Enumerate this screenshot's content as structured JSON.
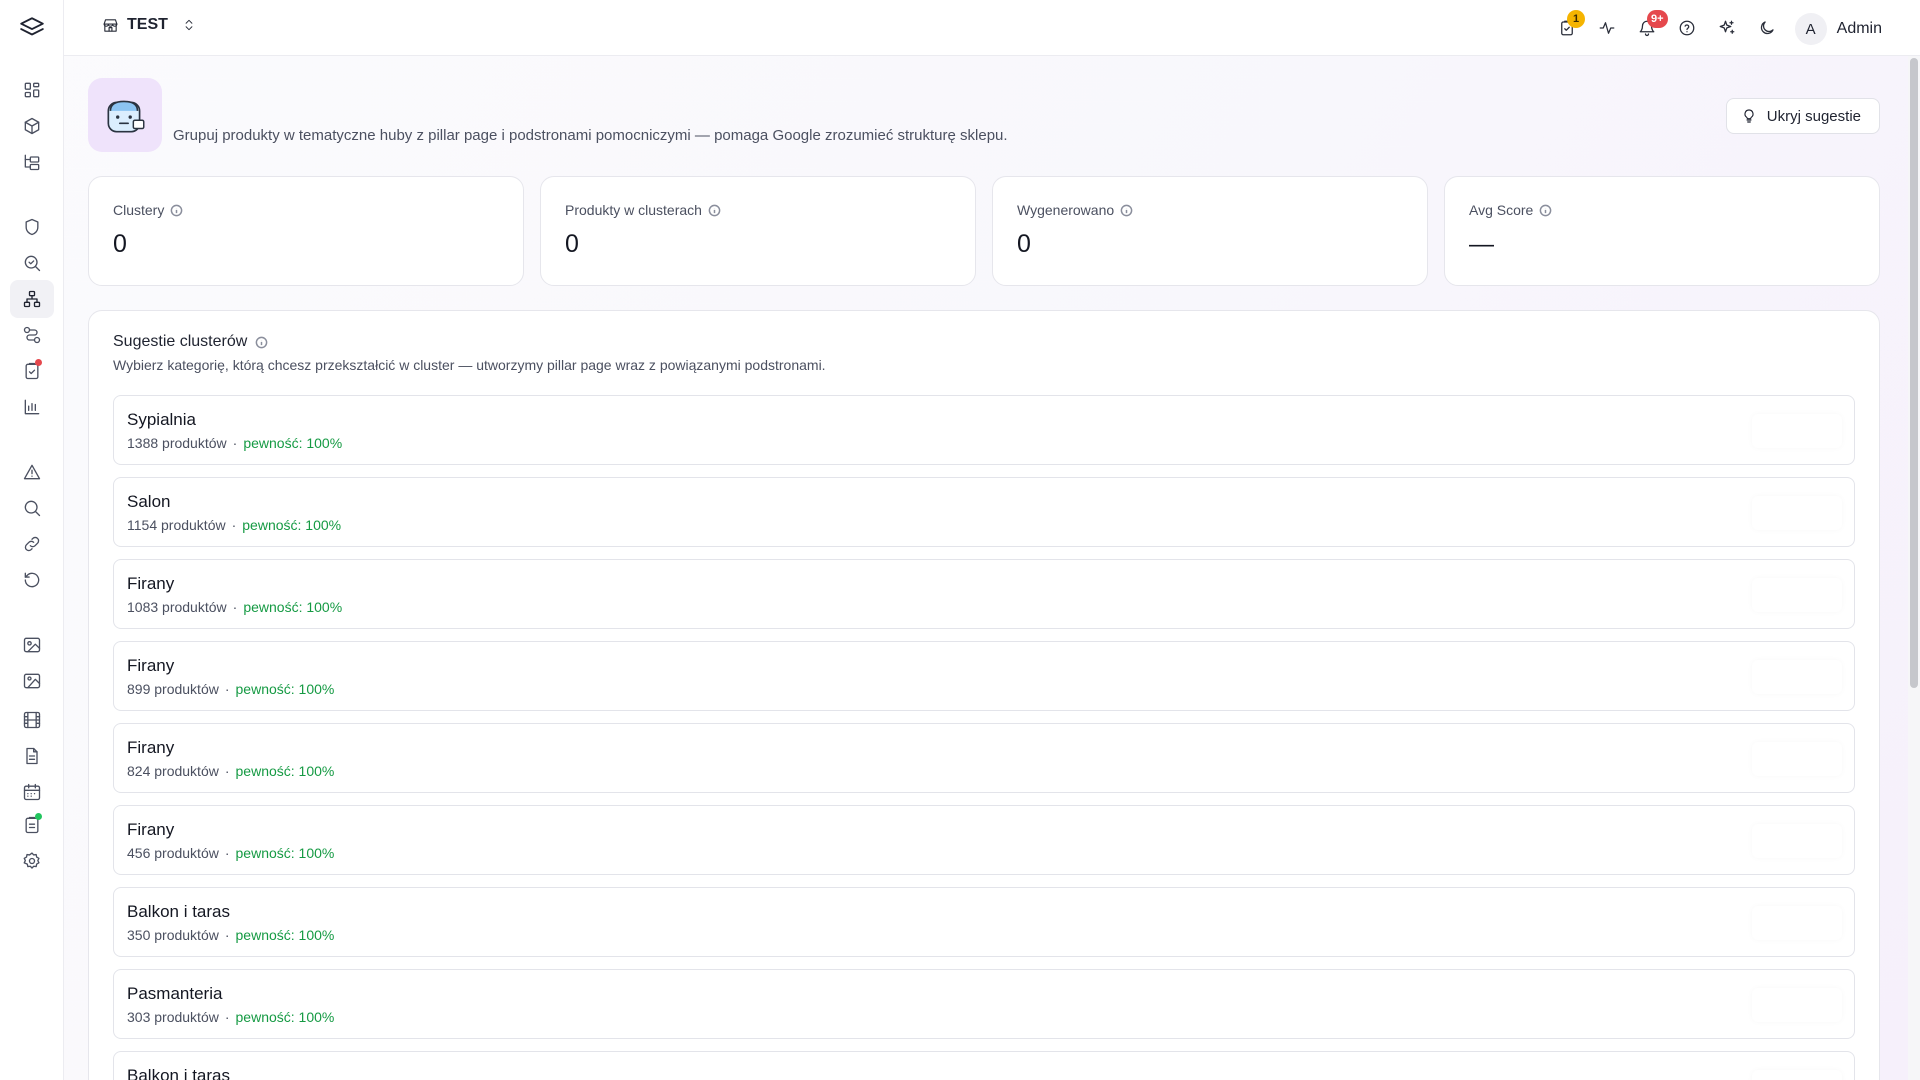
{
  "topbar": {
    "store_name": "TEST",
    "tasks_badge": "1",
    "notifications_badge": "9+",
    "user_initial": "A",
    "user_name": "Admin",
    "icons": [
      "clipboard-check-icon",
      "activity-icon",
      "bell-icon",
      "help-circle-icon",
      "sparkles-icon",
      "moon-icon"
    ]
  },
  "sidebar": {
    "items": [
      {
        "name": "dashboard",
        "icon": "layout-grid-icon"
      },
      {
        "name": "products",
        "icon": "package-icon"
      },
      {
        "name": "categories",
        "icon": "folder-tree-icon"
      },
      {
        "name": "security",
        "icon": "shield-icon"
      },
      {
        "name": "seo-search",
        "icon": "search-check-icon"
      },
      {
        "name": "clusters",
        "icon": "network-icon",
        "active": true
      },
      {
        "name": "workflows",
        "icon": "route-icon"
      },
      {
        "name": "tasks",
        "icon": "clipboard-check-icon",
        "dot": "#e5484d"
      },
      {
        "name": "analytics",
        "icon": "bar-chart-icon"
      },
      {
        "name": "alerts",
        "icon": "alert-triangle-icon"
      },
      {
        "name": "search",
        "icon": "search-icon"
      },
      {
        "name": "links",
        "icon": "link-icon"
      },
      {
        "name": "history",
        "icon": "rotate-ccw-icon"
      },
      {
        "name": "images",
        "icon": "image-icon"
      },
      {
        "name": "gallery",
        "icon": "image-plus-icon"
      },
      {
        "name": "videos",
        "icon": "film-icon"
      },
      {
        "name": "documents",
        "icon": "file-text-icon"
      },
      {
        "name": "calendar",
        "icon": "calendar-icon"
      },
      {
        "name": "reports",
        "icon": "clipboard-list-icon",
        "dot": "#22c55e"
      },
      {
        "name": "settings",
        "icon": "settings-icon"
      }
    ]
  },
  "intro": {
    "description": "Grupuj produkty w tematyczne huby z pillar page i podstronami pomocniczymi — pomaga Google zrozumieć strukturę sklepu.",
    "hide_button": "Ukryj sugestie"
  },
  "stats": [
    {
      "label": "Clustery",
      "value": "0"
    },
    {
      "label": "Produkty w clusterach",
      "value": "0"
    },
    {
      "label": "Wygenerowano",
      "value": "0"
    },
    {
      "label": "Avg Score",
      "value": "—"
    }
  ],
  "suggestions": {
    "title": "Sugestie clusterów",
    "subtitle": "Wybierz kategorię, którą chcesz przekształcić w cluster — utworzymy pillar page wraz z powiązanymi podstronami.",
    "separator": "·",
    "items": [
      {
        "name": "Sypialnia",
        "count": "1388 produktów",
        "confidence": "pewność: 100%"
      },
      {
        "name": "Salon",
        "count": "1154 produktów",
        "confidence": "pewność: 100%"
      },
      {
        "name": "Firany",
        "count": "1083 produktów",
        "confidence": "pewność: 100%"
      },
      {
        "name": "Firany",
        "count": "899 produktów",
        "confidence": "pewność: 100%"
      },
      {
        "name": "Firany",
        "count": "824 produktów",
        "confidence": "pewność: 100%"
      },
      {
        "name": "Firany",
        "count": "456 produktów",
        "confidence": "pewność: 100%"
      },
      {
        "name": "Balkon i taras",
        "count": "350 produktów",
        "confidence": "pewność: 100%"
      },
      {
        "name": "Pasmanteria",
        "count": "303 produktów",
        "confidence": "pewność: 100%"
      },
      {
        "name": "Balkon i taras",
        "count": "",
        "confidence": ""
      }
    ]
  },
  "colors": {
    "accent_green": "#159a43",
    "tasks_badge": "#f5b400",
    "notifications_badge": "#e5484d"
  }
}
